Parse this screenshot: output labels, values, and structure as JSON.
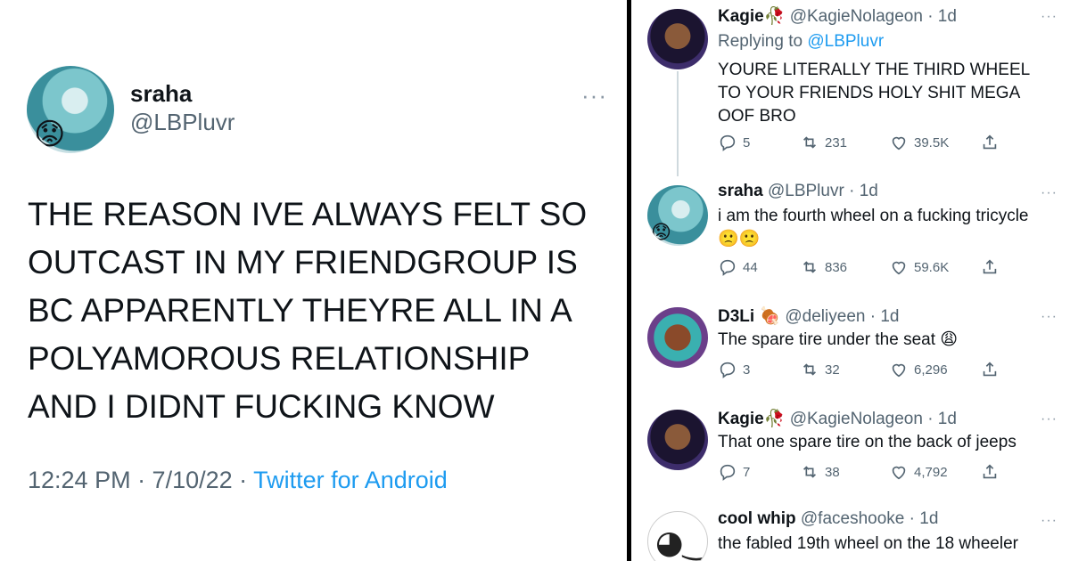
{
  "main_tweet": {
    "name": "sraha",
    "handle": "@LBPluvr",
    "avatar_emoji": "😟",
    "more": "···",
    "lines": [
      "THE REASON IVE ALWAYS FELT SO",
      "OUTCAST IN MY FRIENDGROUP IS",
      "BC APPARENTLY THEYRE ALL IN A",
      "POLYAMOROUS RELATIONSHIP",
      "AND I DIDNT FUCKING KNOW"
    ],
    "time": "12:24 PM · 7/10/22 · ",
    "source": "Twitter for Android"
  },
  "replies": [
    {
      "name": "Kagie🥀",
      "handle": "@KagieNolageon",
      "age": "· 1d",
      "replying_label": "Replying to ",
      "replying_to": "@LBPluvr",
      "text": "YOURE LITERALLY THE THIRD WHEEL TO YOUR FRIENDS HOLY SHIT MEGA OOF BRO",
      "replies": "5",
      "retweets": "231",
      "likes": "39.5K"
    },
    {
      "name": "sraha",
      "handle": "@LBPluvr",
      "age": "· 1d",
      "text": "i am the fourth wheel on a fucking tricycle",
      "emojis": "🙁🙁",
      "avatar_emoji": "😟",
      "replies": "44",
      "retweets": "836",
      "likes": "59.6K"
    },
    {
      "name": "D3Li 🍖",
      "handle": "@deliyeen",
      "age": "· 1d",
      "text": "The spare tire under the seat 😩",
      "replies": "3",
      "retweets": "32",
      "likes": "6,296"
    },
    {
      "name": "Kagie🥀",
      "handle": "@KagieNolageon",
      "age": "· 1d",
      "text": "That one spare tire on the back of jeeps",
      "replies": "7",
      "retweets": "38",
      "likes": "4,792"
    },
    {
      "name": "cool whip",
      "handle": "@faceshooke",
      "age": "· 1d",
      "text": "the fabled 19th wheel on the 18 wheeler",
      "avatar_face": "◕‿◕"
    }
  ],
  "icons": {
    "reply": "reply-icon",
    "retweet": "retweet-icon",
    "like": "heart-icon",
    "share": "share-icon",
    "more": "more-icon"
  },
  "colors": {
    "link": "#1d9bf0",
    "muted": "#536471",
    "text": "#0f1419",
    "divider": "#000000"
  }
}
